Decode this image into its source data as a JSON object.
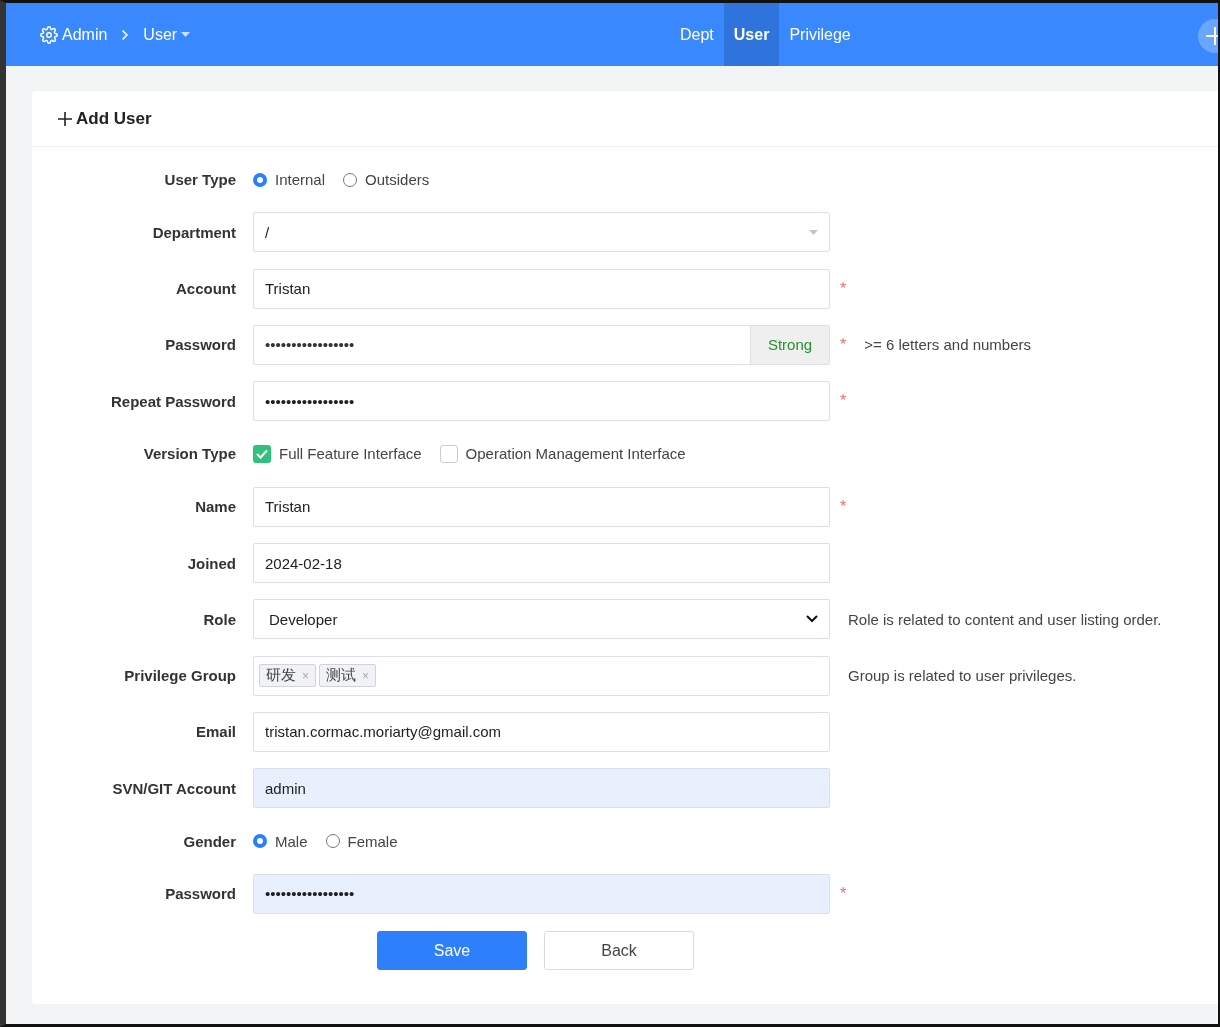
{
  "header": {
    "breadcrumb": [
      {
        "label": "Admin",
        "kind": "home"
      },
      {
        "label": "User",
        "kind": "menu"
      }
    ],
    "tabs": [
      {
        "label": "Dept",
        "selected": false
      },
      {
        "label": "User",
        "selected": true
      },
      {
        "label": "Privilege",
        "selected": false
      }
    ]
  },
  "card": {
    "title": "Add User",
    "fields": [
      {
        "kind": "radio",
        "label": "User Type",
        "options": [
          {
            "label": "Internal",
            "selected": true
          },
          {
            "label": "Outsiders",
            "selected": false
          }
        ]
      },
      {
        "kind": "dropdown",
        "label": "Department",
        "value": "/"
      },
      {
        "kind": "text",
        "label": "Account",
        "value": "Tristan",
        "required_mark": "*"
      },
      {
        "kind": "password",
        "label": "Password",
        "value": "•••••••••••••••••",
        "strength": "Strong",
        "required_mark": "*",
        "hint": ">= 6 letters and numbers"
      },
      {
        "kind": "text",
        "label": "Repeat Password",
        "value": "•••••••••••••••••",
        "required_mark": "*"
      },
      {
        "kind": "checkbox",
        "label": "Version Type",
        "options": [
          {
            "label": "Full Feature Interface",
            "checked": true
          },
          {
            "label": "Operation Management Interface",
            "checked": false
          }
        ]
      },
      {
        "kind": "text",
        "label": "Name",
        "value": "Tristan",
        "required_mark": "*"
      },
      {
        "kind": "text",
        "label": "Joined",
        "value": "2024-02-18"
      },
      {
        "kind": "select",
        "label": "Role",
        "value": "Developer",
        "hint": "Role is related to content and user listing order."
      },
      {
        "kind": "tags",
        "label": "Privilege Group",
        "tags": [
          {
            "label": "研发",
            "remove": "×"
          },
          {
            "label": "测试",
            "remove": "×"
          }
        ],
        "hint": "Group is related to user privileges."
      },
      {
        "kind": "text",
        "label": "Email",
        "value": "tristan.cormac.moriarty@gmail.com"
      },
      {
        "kind": "text",
        "label": "SVN/GIT Account",
        "value": "admin",
        "autofilled": true
      },
      {
        "kind": "radio",
        "label": "Gender",
        "options": [
          {
            "label": "Male",
            "selected": true
          },
          {
            "label": "Female",
            "selected": false
          }
        ]
      },
      {
        "kind": "text",
        "label": "Password",
        "value": "•••••••••••••••••",
        "autofilled": true,
        "required_mark": "*"
      }
    ],
    "buttons": [
      {
        "label": "Save",
        "kind": "primary"
      },
      {
        "label": "Back",
        "kind": "default"
      }
    ]
  }
}
